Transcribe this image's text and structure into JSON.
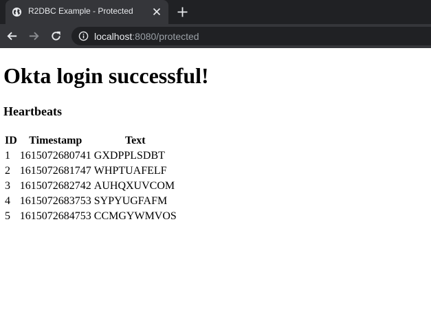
{
  "browser": {
    "tab_title": "R2DBC Example - Protected",
    "url_host": "localhost",
    "url_rest": ":8080/protected",
    "icons": {
      "favicon": "globe-icon",
      "close": "close-icon",
      "new_tab": "plus-icon",
      "back": "back-arrow-icon",
      "forward": "forward-arrow-icon",
      "reload": "reload-icon",
      "info": "info-icon"
    }
  },
  "page": {
    "title": "Okta login successful!",
    "subtitle": "Heartbeats",
    "table": {
      "headers": [
        "ID",
        "Timestamp",
        "Text"
      ],
      "rows": [
        [
          "1",
          "1615072680741",
          "GXDPPLSDBT"
        ],
        [
          "2",
          "1615072681747",
          "WHPTUAFELF"
        ],
        [
          "3",
          "1615072682742",
          "AUHQXUVCOM"
        ],
        [
          "4",
          "1615072683753",
          "SYPYUGFAFM"
        ],
        [
          "5",
          "1615072684753",
          "CCMGYWMVOS"
        ]
      ]
    }
  },
  "colors": {
    "tabstrip_bg": "#202124",
    "toolbar_bg": "#35363a",
    "text_light": "#e8eaed",
    "text_muted": "#9aa0a6"
  }
}
